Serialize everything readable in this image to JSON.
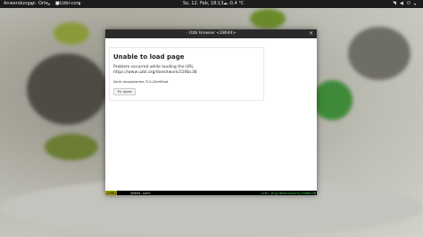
{
  "panel": {
    "activities": "Anwendungen",
    "places": "Orte",
    "app": "Uzbl-core",
    "clock": "So, 12. Feb, 18:13",
    "weather": "-0,4 °C"
  },
  "window": {
    "title": "- Uzbl browser <28644>",
    "close_label": "×"
  },
  "error": {
    "title": "Unable to load page",
    "message": "Problem occurred while loading the URL",
    "url": "https://www.uzbl.org/doesitwork/228bc38",
    "detail": "Nicht akzeptiertes TLS-Zertifikat",
    "try_again": "Try again"
  },
  "statusbar": {
    "mode": "[CMD]",
    "middle": "28644 uzbl",
    "url": "uzbl.org/doesitwork/228bc38"
  },
  "colors": {
    "panel_bg": "#1c1c1c",
    "titlebar_bg": "#2b2b2b",
    "mode_bg": "#9b9b00",
    "url_color": "#5fd75f"
  }
}
